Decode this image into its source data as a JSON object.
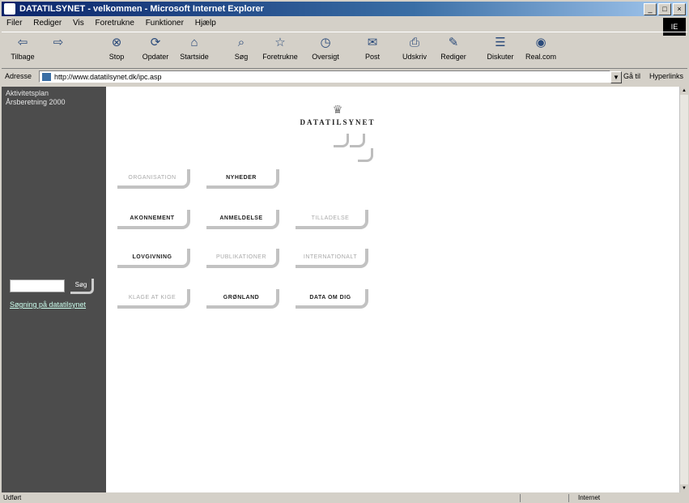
{
  "window": {
    "title": "DATATILSYNET - velkommen - Microsoft Internet Explorer",
    "min": "_",
    "max": "□",
    "close": "×",
    "throbber": "IE"
  },
  "menu": [
    "Filer",
    "Rediger",
    "Vis",
    "Foretrukne",
    "Funktioner",
    "Hjælp"
  ],
  "toolbar": [
    {
      "label": "Tilbage",
      "icon": "back-arrow-icon",
      "glyph": "⇦"
    },
    {
      "label": "",
      "icon": "forward-arrow-icon",
      "glyph": "⇨"
    },
    {
      "label": "Stop",
      "icon": "stop-icon",
      "glyph": "⊗"
    },
    {
      "label": "Opdater",
      "icon": "refresh-icon",
      "glyph": "⟳"
    },
    {
      "label": "Startside",
      "icon": "home-icon",
      "glyph": "⌂"
    },
    {
      "label": "Søg",
      "icon": "search-icon",
      "glyph": "⌕"
    },
    {
      "label": "Foretrukne",
      "icon": "favorites-icon",
      "glyph": "☆"
    },
    {
      "label": "Oversigt",
      "icon": "history-icon",
      "glyph": "◷"
    },
    {
      "label": "Post",
      "icon": "mail-icon",
      "glyph": "✉"
    },
    {
      "label": "Udskriv",
      "icon": "print-icon",
      "glyph": "⎙"
    },
    {
      "label": "Rediger",
      "icon": "edit-icon",
      "glyph": "✎"
    },
    {
      "label": "Diskuter",
      "icon": "discuss-icon",
      "glyph": "☰"
    },
    {
      "label": "Real.com",
      "icon": "realcom-icon",
      "glyph": "◉"
    }
  ],
  "address": {
    "label": "Adresse",
    "url": "http://www.datatilsynet.dk/ipc.asp",
    "go": "Gå til",
    "links": "Hyperlinks"
  },
  "sidebar": {
    "news": [
      "Aktivitetsplan",
      "Årsberetning 2000"
    ],
    "search_button": "Søg",
    "help_link": "Søgning på datatilsynet"
  },
  "logo": {
    "crown": "♛",
    "text": "DATATILSYNET"
  },
  "menu_buttons": [
    {
      "label": "ORGANISATION",
      "style": "light"
    },
    {
      "label": "NYHEDER",
      "style": "dark"
    },
    {
      "label": "AKONNEMENT",
      "style": "dark"
    },
    {
      "label": "ANMELDELSE",
      "style": "dark"
    },
    {
      "label": "TILLADELSE",
      "style": "light"
    },
    {
      "label": "LOVGIVNING",
      "style": "dark"
    },
    {
      "label": "PUBLIKATIONER",
      "style": "light"
    },
    {
      "label": "INTERNATIONALT",
      "style": "light"
    },
    {
      "label": "KLAGE AT KIGE",
      "style": "light"
    },
    {
      "label": "GRØNLAND",
      "style": "dark"
    },
    {
      "label": "DATA OM DIG",
      "style": "dark"
    }
  ],
  "status": {
    "left": "Udført",
    "zone": "Internet"
  }
}
